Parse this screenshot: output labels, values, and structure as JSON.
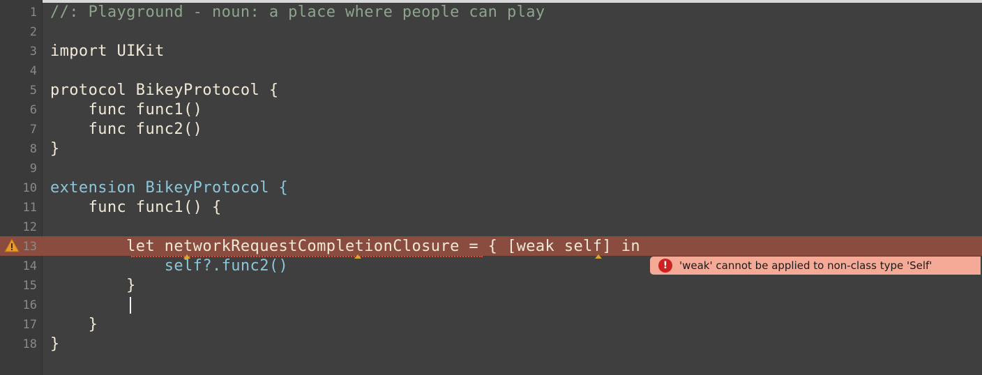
{
  "editor": {
    "lines": [
      {
        "num": "1",
        "text": "//: Playground - noun: a place where people can play"
      },
      {
        "num": "2",
        "text": ""
      },
      {
        "num": "3",
        "text": "import UIKit"
      },
      {
        "num": "4",
        "text": ""
      },
      {
        "num": "5",
        "text": "protocol BikeyProtocol {"
      },
      {
        "num": "6",
        "text": "    func func1()"
      },
      {
        "num": "7",
        "text": "    func func2()"
      },
      {
        "num": "8",
        "text": "}"
      },
      {
        "num": "9",
        "text": ""
      },
      {
        "num": "10",
        "text": "extension BikeyProtocol {"
      },
      {
        "num": "11",
        "text": "    func func1() {"
      },
      {
        "num": "12",
        "text": ""
      },
      {
        "num": "13",
        "text": "        let networkRequestCompletionClosure = { [weak self] in"
      },
      {
        "num": "14",
        "text": "            self?.func2()"
      },
      {
        "num": "15",
        "text": "        }"
      },
      {
        "num": "16",
        "text": ""
      },
      {
        "num": "17",
        "text": "    }"
      },
      {
        "num": "18",
        "text": "}"
      }
    ],
    "highlighted_line": "13",
    "warning_icon": "warning-triangle-icon",
    "error": {
      "icon": "exclamation-circle-icon",
      "message": "'weak' cannot be applied to non-class type 'Self'"
    },
    "colors": {
      "background": "#3f3f3f",
      "comment": "#8ea58d",
      "type": "#8bc6da",
      "error_line": "#8a4c3f",
      "error_pill": "#f4aa96"
    }
  }
}
